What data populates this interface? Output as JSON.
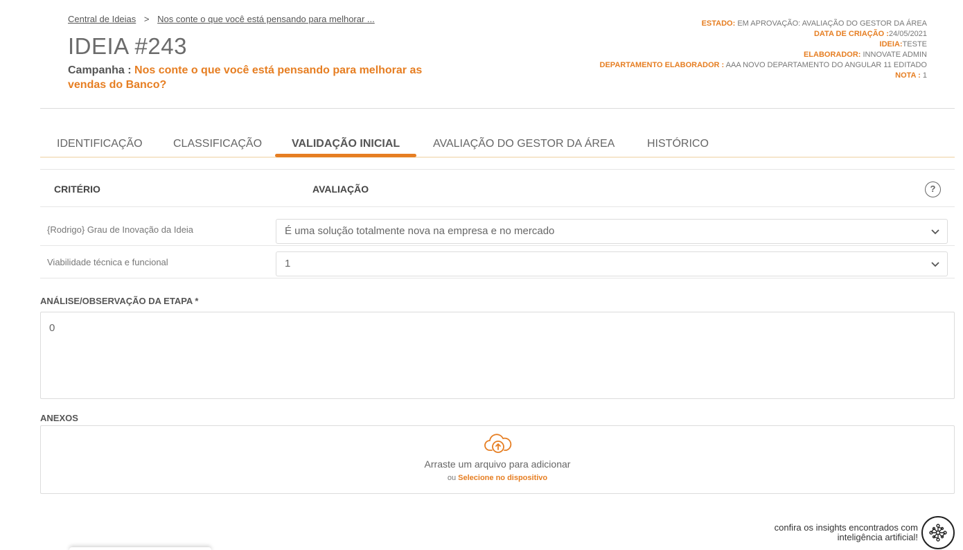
{
  "breadcrumb": {
    "root": "Central de Ideias",
    "separator": ">",
    "current": "Nos conte o que você está pensando para melhorar ..."
  },
  "idea": {
    "title": "IDEIA #243",
    "campaign_label": "Campanha :",
    "campaign_name": "Nos conte o que você está pensando para melhorar as vendas do Banco?"
  },
  "meta": {
    "state_label": "ESTADO:",
    "state_value": "EM APROVAÇÃO: AVALIAÇÃO DO GESTOR DA ÁREA",
    "created_label": "DATA DE CRIAÇÃO :",
    "created_value": "24/05/2021",
    "idea_label": "IDEIA:",
    "idea_value": "TESTE",
    "author_label": "ELABORADOR:",
    "author_value": "INNOVATE ADMIN",
    "dept_label": "DEPARTAMENTO ELABORADOR :",
    "dept_value": "AAA NOVO DEPARTAMENTO DO ANGULAR 11 EDITADO",
    "grade_label": "NOTA :",
    "grade_value": "1"
  },
  "tabs": [
    {
      "label": "IDENTIFICAÇÃO",
      "active": false
    },
    {
      "label": "CLASSIFICAÇÃO",
      "active": false
    },
    {
      "label": "VALIDAÇÃO INICIAL",
      "active": true
    },
    {
      "label": "AVALIAÇÃO DO GESTOR DA ÁREA",
      "active": false
    },
    {
      "label": "HISTÓRICO",
      "active": false
    }
  ],
  "criteria_table": {
    "col_criterion": "CRITÉRIO",
    "col_evaluation": "AVALIAÇÃO",
    "help_symbol": "?",
    "rows": [
      {
        "criterion": "{Rodrigo} Grau de Inovação da Ideia",
        "selected": "É uma solução totalmente nova na empresa e no mercado"
      },
      {
        "criterion": "Viabilidade técnica e funcional",
        "selected": "1"
      }
    ]
  },
  "analysis": {
    "label": "ANÁLISE/OBSERVAÇÃO DA ETAPA *",
    "value": "0"
  },
  "attachments": {
    "label": "ANEXOS",
    "drop_text": "Arraste um arquivo para adicionar",
    "or_text": "ou",
    "select_link": "Selecione no dispositivo",
    "icon": "cloud-upload-icon"
  },
  "ai_insights": {
    "line1": "confira os insights encontrados com",
    "line2": "inteligência artificial!",
    "icon": "ai-network-icon"
  },
  "colors": {
    "accent": "#e67e22",
    "text": "#555555",
    "border": "#dcdcdc"
  }
}
